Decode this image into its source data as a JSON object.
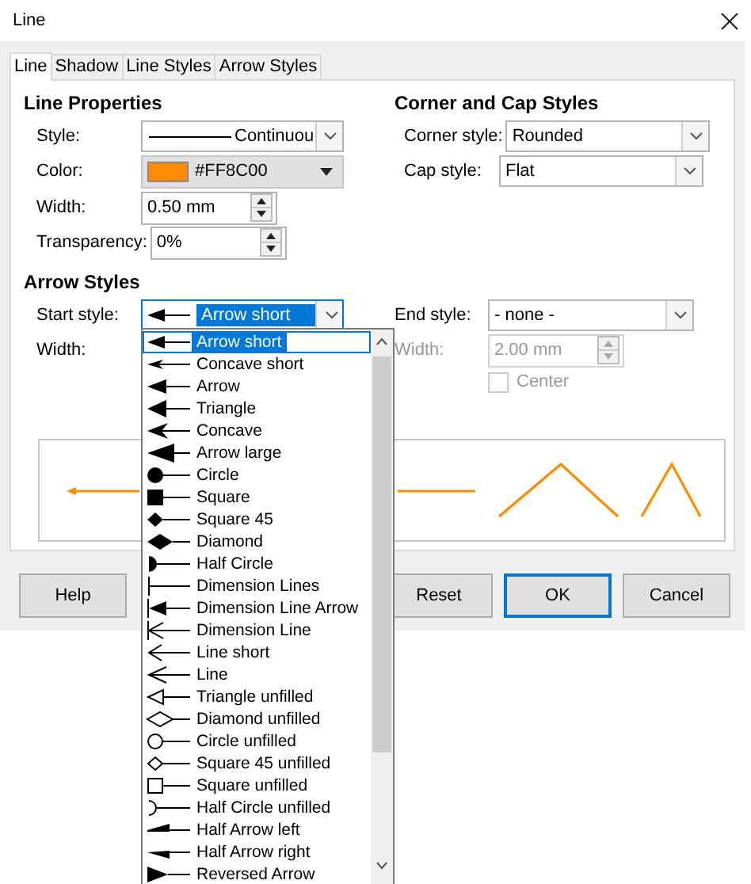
{
  "window": {
    "title": "Line"
  },
  "tabs": [
    {
      "label": "Line",
      "selected": true
    },
    {
      "label": "Shadow",
      "selected": false
    },
    {
      "label": "Line Styles",
      "selected": false
    },
    {
      "label": "Arrow Styles",
      "selected": false
    }
  ],
  "line_properties": {
    "heading": "Line Properties",
    "style": {
      "label": "Style:",
      "value": "Continuou"
    },
    "color": {
      "label": "Color:",
      "value": "#FF8C00"
    },
    "width": {
      "label": "Width:",
      "value": "0.50 mm"
    },
    "transparency": {
      "label": "Transparency:",
      "value": "0%"
    }
  },
  "corner_cap": {
    "heading": "Corner and Cap Styles",
    "corner_style": {
      "label": "Corner style:",
      "value": "Rounded"
    },
    "cap_style": {
      "label": "Cap style:",
      "value": "Flat"
    }
  },
  "arrow_styles": {
    "heading": "Arrow Styles",
    "start_style": {
      "label": "Start style:",
      "value": "Arrow short",
      "kind": "arrowshort",
      "expanded": true
    },
    "start_width": {
      "label": "Width:"
    },
    "end_style": {
      "label": "End style:",
      "value": "- none -"
    },
    "end_width": {
      "label": "Width:",
      "value": "2.00 mm",
      "disabled": true
    },
    "center": {
      "label": "Center",
      "checked": false,
      "disabled": true
    }
  },
  "start_style_options": [
    {
      "label": "Arrow short",
      "kind": "arrowshort",
      "selected": true
    },
    {
      "label": "Concave short",
      "kind": "concaveshort",
      "selected": false
    },
    {
      "label": "Arrow",
      "kind": "arrow",
      "selected": false
    },
    {
      "label": "Triangle",
      "kind": "triangle",
      "selected": false
    },
    {
      "label": "Concave",
      "kind": "concave",
      "selected": false
    },
    {
      "label": "Arrow large",
      "kind": "arrowlarge",
      "selected": false
    },
    {
      "label": "Circle",
      "kind": "circle",
      "selected": false
    },
    {
      "label": "Square",
      "kind": "square",
      "selected": false
    },
    {
      "label": "Square 45",
      "kind": "square45",
      "selected": false
    },
    {
      "label": "Diamond",
      "kind": "diamond",
      "selected": false
    },
    {
      "label": "Half Circle",
      "kind": "halfcircle",
      "selected": false
    },
    {
      "label": "Dimension Lines",
      "kind": "dimensionlines",
      "selected": false
    },
    {
      "label": "Dimension Line Arrow",
      "kind": "dimensionlinearrow",
      "selected": false
    },
    {
      "label": "Dimension Line",
      "kind": "dimensionline",
      "selected": false
    },
    {
      "label": "Line short",
      "kind": "lineshort",
      "selected": false
    },
    {
      "label": "Line",
      "kind": "line",
      "selected": false
    },
    {
      "label": "Triangle unfilled",
      "kind": "triangleunfilled",
      "selected": false
    },
    {
      "label": "Diamond unfilled",
      "kind": "diamondunfilled",
      "selected": false
    },
    {
      "label": "Circle unfilled",
      "kind": "circleunfilled",
      "selected": false
    },
    {
      "label": "Square 45 unfilled",
      "kind": "square45unfilled",
      "selected": false
    },
    {
      "label": "Square unfilled",
      "kind": "squareunfilled",
      "selected": false
    },
    {
      "label": "Half Circle unfilled",
      "kind": "halfcircleunfilled",
      "selected": false
    },
    {
      "label": "Half Arrow left",
      "kind": "halfarrowleft",
      "selected": false
    },
    {
      "label": "Half Arrow right",
      "kind": "halfarrowright",
      "selected": false
    },
    {
      "label": "Reversed Arrow",
      "kind": "reversedarrow",
      "selected": false
    }
  ],
  "buttons_left": [
    {
      "label": "Help",
      "default": false
    }
  ],
  "buttons_right": [
    {
      "label": "Reset",
      "default": false
    },
    {
      "label": "OK",
      "default": true
    },
    {
      "label": "Cancel",
      "default": false
    }
  ]
}
